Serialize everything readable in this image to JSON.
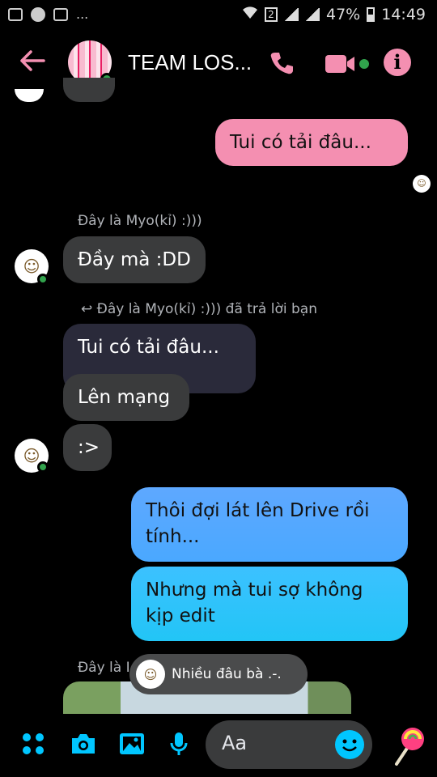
{
  "status_bar": {
    "left_icons": [
      "video-icon",
      "messenger-icon",
      "gallery-icon"
    ],
    "overflow": "...",
    "sim_label": "2",
    "battery": "47%",
    "time": "14:49"
  },
  "header": {
    "title": "TEAM LOS...",
    "back_icon": "back-arrow-icon",
    "call_icon": "phone-icon",
    "video_icon": "video-call-icon",
    "info_label": "i",
    "accent_color": "#f48fb1"
  },
  "messages": [
    {
      "id": "m1",
      "side": "right",
      "text": "Tui có tải đâu..."
    },
    {
      "id": "m2",
      "side": "left",
      "sender": "Đây là Myo(kỉ) :)))",
      "text": "Đầy mà :DD"
    },
    {
      "id": "m3",
      "side": "left",
      "reply_note": "Đây là Myo(kỉ) :))) đã trả lời bạn",
      "quoted": "Tui có tải đâu...",
      "text": "Lên mạng"
    },
    {
      "id": "m4",
      "side": "left",
      "text": ":>"
    },
    {
      "id": "m5",
      "side": "right",
      "text": "Thôi đợi lát lên Drive rồi tính..."
    },
    {
      "id": "m6",
      "side": "right",
      "text": "Nhưng mà tui sợ không kịp edit"
    },
    {
      "id": "m7",
      "side": "left",
      "sender": "Đây là I"
    }
  ],
  "toast": {
    "text": "Nhiều đâu bà .-."
  },
  "composer": {
    "placeholder": "Aa",
    "icons": [
      "apps-icon",
      "camera-icon",
      "image-icon",
      "microphone-icon",
      "emoji-icon",
      "lollipop-icon"
    ]
  }
}
